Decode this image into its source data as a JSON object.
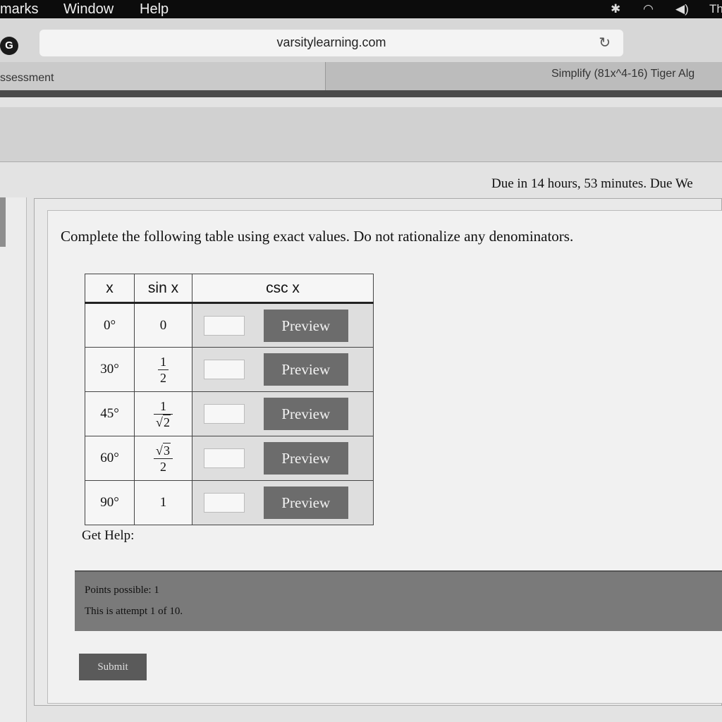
{
  "menubar": {
    "items": [
      "marks",
      "Window",
      "Help"
    ],
    "clock": "Th"
  },
  "browser": {
    "site_icon": "G",
    "url": "varsitylearning.com",
    "tabs": [
      {
        "label": "ssessment"
      },
      {
        "label": "Simplify (81x^4-16) Tiger Alg"
      }
    ]
  },
  "assignment": {
    "due_text": "Due in 14 hours, 53 minutes. Due We"
  },
  "question": {
    "prompt": "Complete the following table using exact values. Do not rationalize any denominators.",
    "table": {
      "headers": [
        "x",
        "sin x",
        "csc x"
      ],
      "rows": [
        {
          "x": "0°",
          "sin": {
            "kind": "plain",
            "text": "0"
          }
        },
        {
          "x": "30°",
          "sin": {
            "kind": "frac",
            "num": "1",
            "den": "2"
          }
        },
        {
          "x": "45°",
          "sin": {
            "kind": "frac",
            "num": "1",
            "den_radicand": "2"
          }
        },
        {
          "x": "60°",
          "sin": {
            "kind": "frac",
            "num_radicand": "3",
            "den": "2"
          }
        },
        {
          "x": "90°",
          "sin": {
            "kind": "plain",
            "text": "1"
          }
        }
      ],
      "csc_answer_values": [
        "",
        "",
        "",
        "",
        ""
      ],
      "preview_label": "Preview"
    },
    "get_help_label": "Get Help:",
    "points_possible": "Points possible: 1",
    "attempt_text": "This is attempt 1 of 10.",
    "submit_label": "Submit"
  }
}
